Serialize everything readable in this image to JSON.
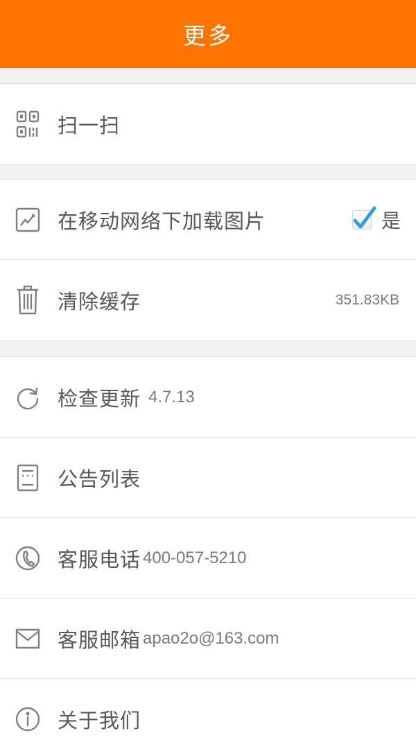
{
  "header": {
    "title": "更多"
  },
  "rows": {
    "scan": {
      "label": "扫一扫",
      "icon": "qr-code-icon"
    },
    "load_images": {
      "label": "在移动网络下加载图片",
      "icon": "image-chart-icon",
      "checked": true,
      "toggle_label": "是"
    },
    "clear_cache": {
      "label": "清除缓存",
      "icon": "trash-icon",
      "value": "351.83KB"
    },
    "check_update": {
      "label": "检查更新",
      "icon": "refresh-icon",
      "value": "4.7.13"
    },
    "announcements": {
      "label": "公告列表",
      "icon": "notice-list-icon"
    },
    "service_phone": {
      "label": "客服电话",
      "icon": "phone-icon",
      "value": "400-057-5210"
    },
    "service_email": {
      "label": "客服邮箱",
      "icon": "mail-icon",
      "value": "apao2o@163.com"
    },
    "about_us": {
      "label": "关于我们",
      "icon": "info-icon"
    }
  },
  "colors": {
    "header": "#ff7300",
    "background": "#f2f2f2",
    "icon": "#7f7f7f",
    "check": "#2f9fe0"
  }
}
